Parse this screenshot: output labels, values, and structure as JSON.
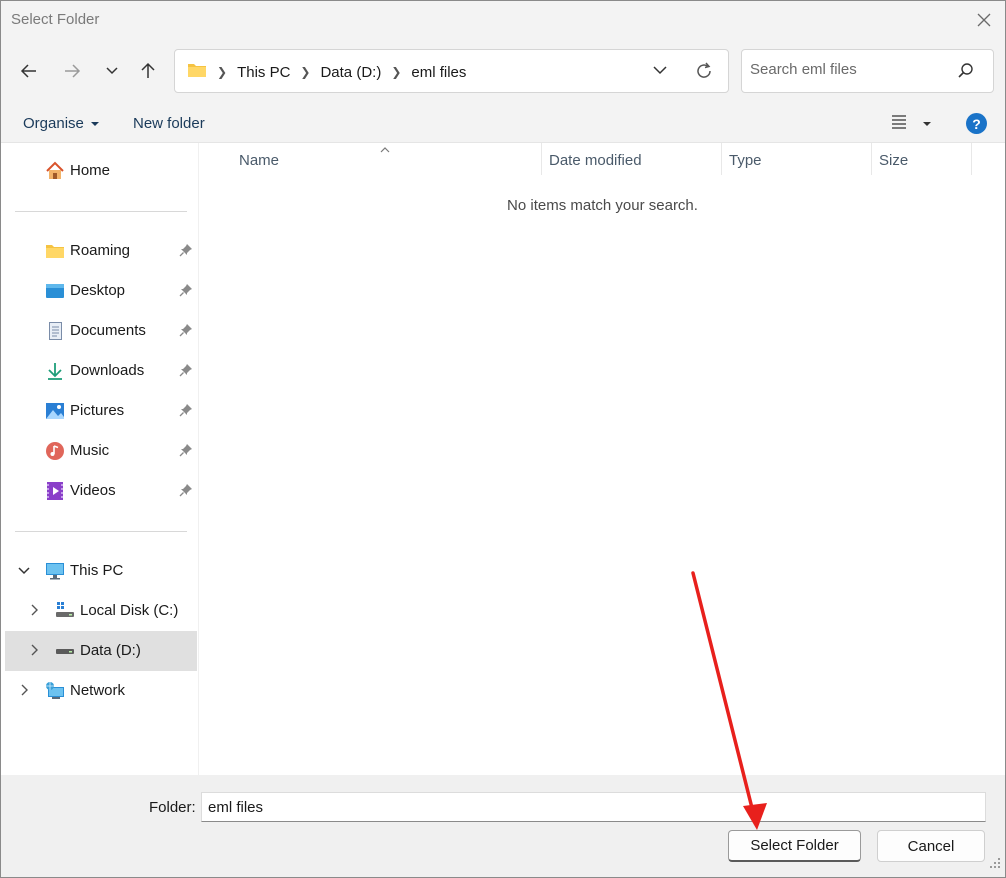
{
  "window": {
    "title": "Select Folder"
  },
  "nav": {
    "breadcrumbs": [
      "This PC",
      "Data (D:)",
      "eml files"
    ],
    "search_placeholder": "Search eml files"
  },
  "commands": {
    "organise": "Organise",
    "new_folder": "New folder"
  },
  "sidebar": {
    "home": "Home",
    "quick_access": [
      {
        "label": "Roaming",
        "icon": "folder-icon"
      },
      {
        "label": "Desktop",
        "icon": "desktop-icon"
      },
      {
        "label": "Documents",
        "icon": "documents-icon"
      },
      {
        "label": "Downloads",
        "icon": "download-icon"
      },
      {
        "label": "Pictures",
        "icon": "pictures-icon"
      },
      {
        "label": "Music",
        "icon": "music-icon"
      },
      {
        "label": "Videos",
        "icon": "videos-icon"
      }
    ],
    "this_pc": "This PC",
    "drives": [
      {
        "label": "Local Disk (C:)",
        "icon": "windows-drive-icon"
      },
      {
        "label": "Data (D:)",
        "icon": "drive-icon",
        "selected": true
      }
    ],
    "network": "Network"
  },
  "columns": [
    "Name",
    "Date modified",
    "Type",
    "Size"
  ],
  "empty_message": "No items match your search.",
  "footer": {
    "folder_label": "Folder:",
    "folder_value": "eml files",
    "select_button": "Select Folder",
    "cancel_button": "Cancel"
  },
  "colors": {
    "accent": "#1a73c8",
    "annotation_arrow": "#e8201c",
    "chrome": "#f3f3f3",
    "selected": "#e0e0e0"
  }
}
